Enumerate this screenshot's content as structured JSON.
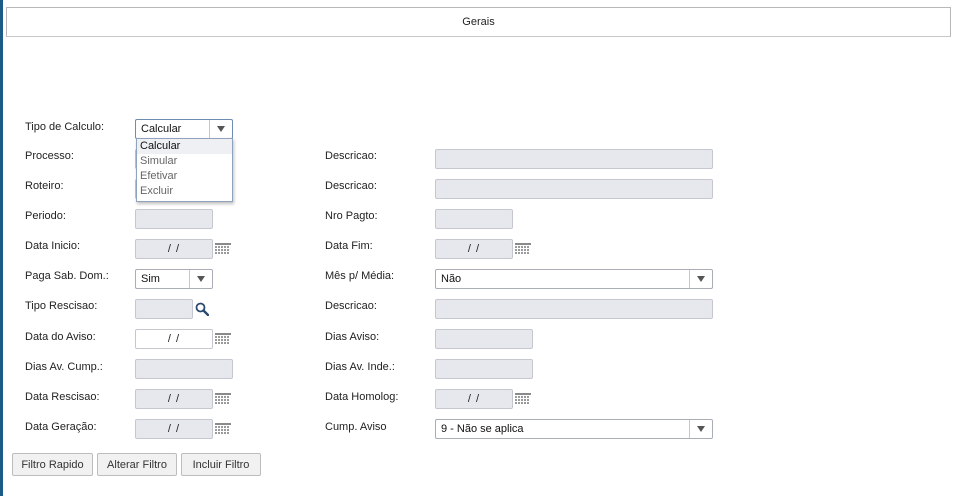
{
  "tab": {
    "title": "Gerais"
  },
  "form": {
    "tipo_calculo": {
      "label": "Tipo de Calculo:",
      "value": "Calcular",
      "options": [
        "Calcular",
        "Simular",
        "Efetivar",
        "Excluir"
      ]
    },
    "processo": {
      "label": "Processo:"
    },
    "descricao1": {
      "label": "Descricao:"
    },
    "roteiro": {
      "label": "Roteiro:"
    },
    "descricao2": {
      "label": "Descricao:"
    },
    "periodo": {
      "label": "Periodo:"
    },
    "nro_pagto": {
      "label": "Nro Pagto:"
    },
    "data_inicio": {
      "label": "Data Inicio:",
      "value": "/ /"
    },
    "data_fim": {
      "label": "Data Fim:",
      "value": "/ /"
    },
    "paga_sab_dom": {
      "label": "Paga Sab. Dom.:",
      "value": "Sim"
    },
    "mes_media": {
      "label": "Mês p/ Média:",
      "value": "Não"
    },
    "tipo_rescisao": {
      "label": "Tipo Rescisao:"
    },
    "descricao3": {
      "label": "Descricao:"
    },
    "data_aviso": {
      "label": "Data do Aviso:",
      "value": "/ /"
    },
    "dias_aviso": {
      "label": "Dias Aviso:"
    },
    "dias_av_cump": {
      "label": "Dias Av. Cump.:"
    },
    "dias_av_inde": {
      "label": "Dias Av. Inde.:"
    },
    "data_rescisao": {
      "label": "Data Rescisao:",
      "value": "/ /"
    },
    "data_homolog": {
      "label": "Data Homolog:",
      "value": "/ /"
    },
    "data_geracao": {
      "label": "Data Geração:",
      "value": "/ /"
    },
    "cump_aviso": {
      "label": "Cump. Aviso",
      "value": "9 - Não se aplica"
    }
  },
  "buttons": {
    "filtro_rapido": "Filtro Rapido",
    "alterar_filtro": "Alterar Filtro",
    "incluir_filtro": "Incluir Filtro"
  },
  "colors": {
    "accent": "#1c5b87",
    "field_bg": "#e6e8ee",
    "dropdown_border": "#8fa3bf"
  }
}
